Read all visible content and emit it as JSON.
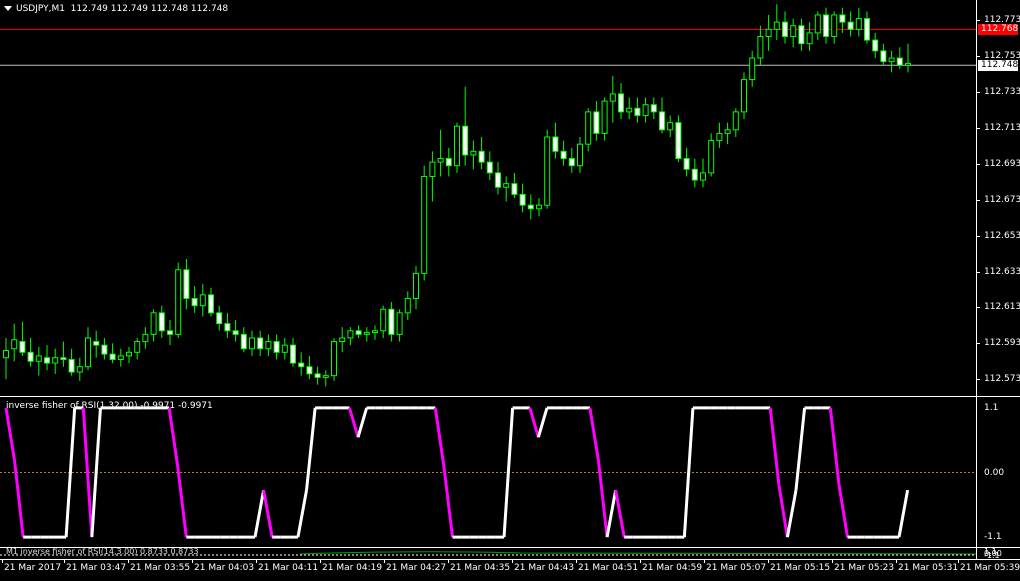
{
  "window": {
    "symbol_title": "USDJPY,M1  112.749 112.749 112.748 112.748"
  },
  "price_axis": {
    "labels": [
      "112.773",
      "112.753",
      "112.733",
      "112.713",
      "112.693",
      "112.673",
      "112.653",
      "112.633",
      "112.613",
      "112.593",
      "112.573"
    ],
    "values": [
      112.773,
      112.753,
      112.733,
      112.713,
      112.693,
      112.673,
      112.653,
      112.633,
      112.613,
      112.593,
      112.573
    ],
    "ask_line": {
      "value": 112.768,
      "label": "112.768",
      "color": "#ff0000"
    },
    "bid_line": {
      "value": 112.748,
      "label": "112.748",
      "color": "#c0c0c0"
    }
  },
  "indicator1": {
    "title": "inverse fisher of RSI(1,32.00) -0.9971 -0.9971",
    "levels": [
      "1.1",
      "0.00",
      "-1.1"
    ],
    "color_up": "#ffffff",
    "color_down": "#ff00ff"
  },
  "indicator2": {
    "title": "M1 inverse fisher of RSI(14,3.00) 0.8733 0.8733",
    "levels": [
      "1.1",
      "0.00",
      "-1.1"
    ]
  },
  "time_axis": {
    "labels": [
      "21 Mar 2017",
      "21 Mar 03:47",
      "21 Mar 03:55",
      "21 Mar 04:03",
      "21 Mar 04:11",
      "21 Mar 04:19",
      "21 Mar 04:27",
      "21 Mar 04:35",
      "21 Mar 04:43",
      "21 Mar 04:51",
      "21 Mar 04:59",
      "21 Mar 05:07",
      "21 Mar 05:15",
      "21 Mar 05:23",
      "21 Mar 05:31",
      "21 Mar 05:39"
    ]
  },
  "colors": {
    "background": "#000000",
    "candle": "#00ff00",
    "bull_body": "#000000",
    "bear_body": "#ffffff",
    "foreground": "#ffffff"
  },
  "chart_data": {
    "type": "candlestick",
    "title": "USDJPY,M1",
    "ylim": [
      112.567,
      112.781
    ],
    "candles": [
      [
        112.585,
        112.596,
        112.573,
        112.589
      ],
      [
        112.59,
        112.604,
        112.583,
        112.595
      ],
      [
        112.594,
        112.605,
        112.586,
        112.588
      ],
      [
        112.588,
        112.596,
        112.58,
        112.583
      ],
      [
        112.583,
        112.591,
        112.575,
        112.586
      ],
      [
        112.585,
        112.592,
        112.578,
        112.582
      ],
      [
        112.582,
        112.59,
        112.576,
        112.585
      ],
      [
        112.585,
        112.594,
        112.58,
        112.584
      ],
      [
        112.584,
        112.59,
        112.575,
        112.577
      ],
      [
        112.577,
        112.585,
        112.572,
        112.58
      ],
      [
        112.58,
        112.602,
        112.578,
        112.596
      ],
      [
        112.594,
        112.6,
        112.585,
        112.592
      ],
      [
        112.592,
        112.596,
        112.584,
        112.587
      ],
      [
        112.587,
        112.593,
        112.582,
        112.584
      ],
      [
        112.584,
        112.59,
        112.58,
        112.586
      ],
      [
        112.586,
        112.591,
        112.582,
        112.588
      ],
      [
        112.588,
        112.596,
        112.584,
        112.594
      ],
      [
        112.594,
        112.602,
        112.59,
        112.598
      ],
      [
        112.598,
        112.612,
        112.594,
        112.61
      ],
      [
        112.61,
        112.614,
        112.596,
        112.6
      ],
      [
        112.6,
        112.606,
        112.592,
        112.598
      ],
      [
        112.598,
        112.638,
        112.596,
        112.634
      ],
      [
        112.634,
        112.64,
        112.612,
        112.618
      ],
      [
        112.618,
        112.625,
        112.61,
        112.614
      ],
      [
        112.614,
        112.626,
        112.608,
        112.62
      ],
      [
        112.62,
        112.624,
        112.608,
        112.61
      ],
      [
        112.61,
        112.614,
        112.6,
        112.604
      ],
      [
        112.604,
        112.61,
        112.596,
        112.6
      ],
      [
        112.6,
        112.606,
        112.594,
        112.598
      ],
      [
        112.598,
        112.602,
        112.588,
        112.59
      ],
      [
        112.59,
        112.6,
        112.586,
        112.596
      ],
      [
        112.596,
        112.6,
        112.586,
        112.59
      ],
      [
        112.59,
        112.598,
        112.586,
        112.594
      ],
      [
        112.594,
        112.598,
        112.584,
        112.588
      ],
      [
        112.588,
        112.596,
        112.584,
        112.592
      ],
      [
        112.592,
        112.596,
        112.58,
        112.582
      ],
      [
        112.582,
        112.588,
        112.575,
        112.58
      ],
      [
        112.58,
        112.586,
        112.573,
        112.576
      ],
      [
        112.576,
        112.58,
        112.57,
        112.574
      ],
      [
        112.574,
        112.578,
        112.569,
        112.575
      ],
      [
        112.575,
        112.596,
        112.572,
        112.594
      ],
      [
        112.594,
        112.602,
        112.588,
        112.596
      ],
      [
        112.596,
        112.602,
        112.592,
        112.6
      ],
      [
        112.6,
        112.603,
        112.596,
        112.598
      ],
      [
        112.598,
        112.602,
        112.594,
        112.599
      ],
      [
        112.599,
        112.603,
        112.595,
        112.6
      ],
      [
        112.6,
        112.614,
        112.596,
        112.612
      ],
      [
        112.612,
        112.616,
        112.594,
        112.598
      ],
      [
        112.598,
        112.612,
        112.594,
        112.61
      ],
      [
        112.61,
        112.622,
        112.606,
        112.618
      ],
      [
        112.618,
        112.636,
        112.612,
        112.632
      ],
      [
        112.632,
        112.692,
        112.628,
        112.686
      ],
      [
        112.686,
        112.7,
        112.672,
        112.694
      ],
      [
        112.694,
        112.712,
        112.686,
        112.696
      ],
      [
        112.696,
        112.702,
        112.686,
        112.692
      ],
      [
        112.692,
        112.716,
        112.688,
        112.714
      ],
      [
        112.714,
        112.736,
        112.692,
        112.698
      ],
      [
        112.698,
        112.706,
        112.69,
        112.7
      ],
      [
        112.7,
        112.708,
        112.69,
        112.694
      ],
      [
        112.694,
        112.7,
        112.684,
        112.688
      ],
      [
        112.688,
        112.694,
        112.676,
        112.68
      ],
      [
        112.68,
        112.686,
        112.672,
        112.682
      ],
      [
        112.682,
        112.688,
        112.674,
        112.676
      ],
      [
        112.676,
        112.682,
        112.666,
        112.67
      ],
      [
        112.67,
        112.676,
        112.662,
        112.668
      ],
      [
        112.668,
        112.674,
        112.664,
        112.67
      ],
      [
        112.67,
        112.712,
        112.668,
        112.708
      ],
      [
        112.708,
        112.716,
        112.696,
        112.7
      ],
      [
        112.7,
        112.706,
        112.692,
        112.696
      ],
      [
        112.696,
        112.702,
        112.688,
        112.692
      ],
      [
        112.692,
        112.708,
        112.688,
        112.704
      ],
      [
        112.704,
        112.724,
        112.7,
        112.722
      ],
      [
        112.722,
        112.728,
        112.706,
        112.71
      ],
      [
        112.71,
        112.73,
        112.706,
        112.728
      ],
      [
        112.728,
        112.742,
        112.716,
        112.732
      ],
      [
        112.732,
        112.738,
        112.718,
        112.722
      ],
      [
        112.722,
        112.73,
        112.718,
        112.724
      ],
      [
        112.724,
        112.73,
        112.716,
        112.72
      ],
      [
        112.72,
        112.73,
        112.716,
        112.726
      ],
      [
        112.726,
        112.73,
        112.718,
        112.722
      ],
      [
        112.722,
        112.73,
        112.71,
        112.712
      ],
      [
        112.712,
        112.72,
        112.708,
        112.716
      ],
      [
        112.716,
        112.72,
        112.694,
        112.696
      ],
      [
        112.696,
        112.702,
        112.686,
        112.69
      ],
      [
        112.69,
        112.696,
        112.68,
        112.684
      ],
      [
        112.684,
        112.696,
        112.68,
        112.688
      ],
      [
        112.688,
        112.71,
        112.686,
        112.706
      ],
      [
        112.706,
        112.716,
        112.702,
        112.71
      ],
      [
        112.71,
        112.716,
        112.704,
        112.712
      ],
      [
        112.712,
        112.724,
        112.708,
        112.722
      ],
      [
        112.722,
        112.744,
        112.718,
        112.74
      ],
      [
        112.74,
        112.756,
        112.736,
        112.752
      ],
      [
        112.752,
        112.77,
        112.748,
        112.764
      ],
      [
        112.764,
        112.776,
        112.756,
        112.768
      ],
      [
        112.768,
        112.782,
        112.762,
        112.772
      ],
      [
        112.772,
        112.778,
        112.76,
        112.764
      ],
      [
        112.764,
        112.774,
        112.758,
        112.77
      ],
      [
        112.77,
        112.774,
        112.756,
        112.76
      ],
      [
        112.76,
        112.772,
        112.756,
        112.766
      ],
      [
        112.766,
        112.778,
        112.762,
        112.776
      ],
      [
        112.776,
        112.78,
        112.76,
        112.764
      ],
      [
        112.764,
        112.778,
        112.76,
        112.776
      ],
      [
        112.776,
        112.78,
        112.766,
        112.772
      ],
      [
        112.772,
        112.778,
        112.764,
        112.768
      ],
      [
        112.768,
        112.78,
        112.764,
        112.774
      ],
      [
        112.774,
        112.778,
        112.76,
        112.762
      ],
      [
        112.762,
        112.766,
        112.752,
        112.756
      ],
      [
        112.756,
        112.76,
        112.748,
        112.75
      ],
      [
        112.75,
        112.756,
        112.744,
        112.752
      ],
      [
        112.752,
        112.758,
        112.746,
        112.748
      ],
      [
        112.748,
        112.76,
        112.744,
        112.749
      ]
    ],
    "indicator_series": [
      1.1,
      0.2,
      -1.1,
      -1.1,
      -1.1,
      -1.1,
      -1.1,
      -1.1,
      1.1,
      1.1,
      -1.1,
      1.1,
      1.1,
      1.1,
      1.1,
      1.1,
      1.1,
      1.1,
      1.1,
      1.1,
      0.1,
      -1.1,
      -1.1,
      -1.1,
      -1.1,
      -1.1,
      -1.1,
      -1.1,
      -1.1,
      -1.1,
      -0.3,
      -1.1,
      -1.1,
      -1.1,
      -1.1,
      -0.3,
      1.1,
      1.1,
      1.1,
      1.1,
      1.1,
      0.6,
      1.1,
      1.1,
      1.1,
      1.1,
      1.1,
      1.1,
      1.1,
      1.1,
      1.1,
      0.1,
      -1.1,
      -1.1,
      -1.1,
      -1.1,
      -1.1,
      -1.1,
      -1.1,
      1.1,
      1.1,
      1.1,
      0.6,
      1.1,
      1.1,
      1.1,
      1.1,
      1.1,
      1.1,
      0.2,
      -1.1,
      -0.3,
      -1.1,
      -1.1,
      -1.1,
      -1.1,
      -1.1,
      -1.1,
      -1.1,
      -1.1,
      1.1,
      1.1,
      1.1,
      1.1,
      1.1,
      1.1,
      1.1,
      1.1,
      1.1,
      1.1,
      -0.2,
      -1.1,
      -0.3,
      1.1,
      1.1,
      1.1,
      1.1,
      -0.2,
      -1.1,
      -1.1,
      -1.1,
      -1.1,
      -1.1,
      -1.1,
      -1.1,
      -0.3
    ],
    "indicator_ylim": [
      -1.2,
      1.2
    ]
  }
}
